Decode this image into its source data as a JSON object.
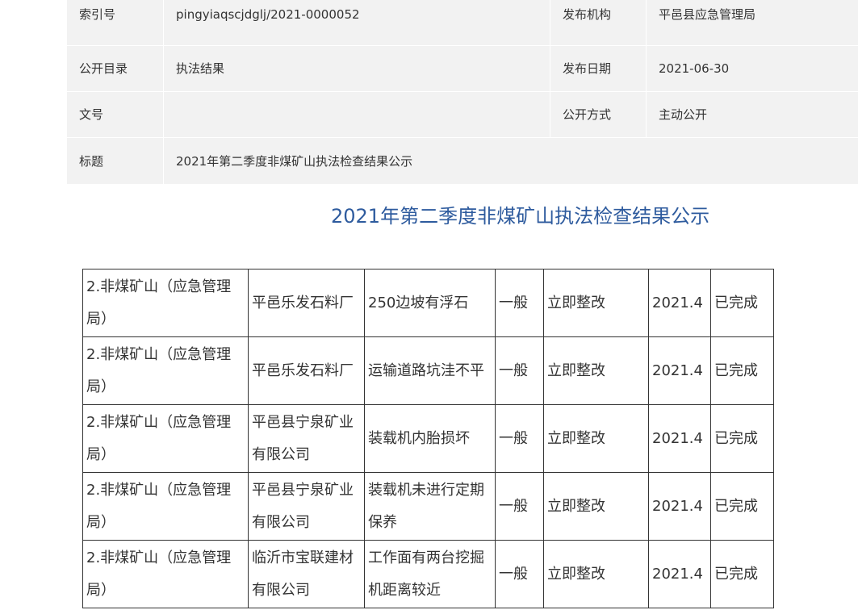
{
  "meta": {
    "index_no_label": "索引号",
    "index_no_value": "pingyiaqscjdglj/2021-0000052",
    "publisher_label": "发布机构",
    "publisher_value": "平邑县应急管理局",
    "catalog_label": "公开目录",
    "catalog_value": "执法结果",
    "date_label": "发布日期",
    "date_value": "2021-06-30",
    "doc_no_label": "文号",
    "doc_no_value": "",
    "method_label": "公开方式",
    "method_value": "主动公开",
    "title_label": "标题",
    "title_value": "2021年第二季度非煤矿山执法检查结果公示"
  },
  "heading": "2021年第二季度非煤矿山执法检查结果公示",
  "table": {
    "rows": [
      [
        "2.非煤矿山（应急管理局）",
        "平邑乐发石料厂",
        "250边坡有浮石",
        "一般",
        "立即整改",
        "2021.4",
        "已完成"
      ],
      [
        "2.非煤矿山（应急管理局）",
        "平邑乐发石料厂",
        "运输道路坑洼不平",
        "一般",
        "立即整改",
        "2021.4",
        "已完成"
      ],
      [
        "2.非煤矿山（应急管理局）",
        "平邑县宁泉矿业有限公司",
        "装载机内胎损坏",
        "一般",
        "立即整改",
        "2021.4",
        "已完成"
      ],
      [
        "2.非煤矿山（应急管理局）",
        "平邑县宁泉矿业有限公司",
        "装载机未进行定期保养",
        "一般",
        "立即整改",
        "2021.4",
        "已完成"
      ],
      [
        "2.非煤矿山（应急管理局）",
        "临沂市宝联建材有限公司",
        "工作面有两台挖掘机距离较近",
        "一般",
        "立即整改",
        "2021.4",
        "已完成"
      ]
    ]
  }
}
